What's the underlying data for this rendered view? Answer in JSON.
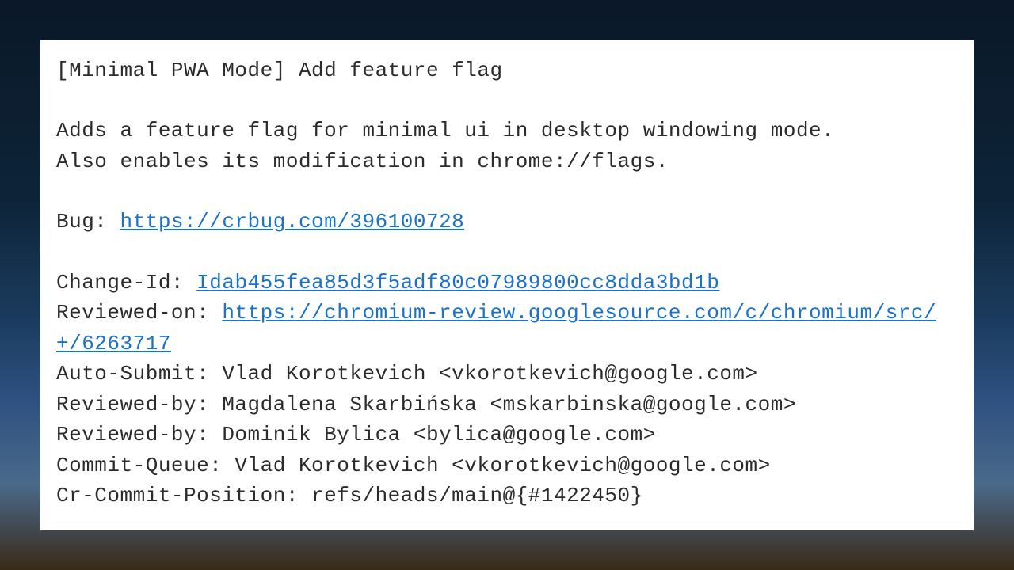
{
  "commit": {
    "title": "[Minimal PWA Mode] Add feature flag",
    "description_line1": "Adds a feature flag for minimal ui in desktop windowing mode.",
    "description_line2": "Also enables its modification in chrome://flags.",
    "bug_label": "Bug: ",
    "bug_url": "https://crbug.com/396100728",
    "change_id_label": "Change-Id: ",
    "change_id": "Idab455fea85d3f5adf80c07989800cc8dda3bd1b",
    "reviewed_on_label": "Reviewed-on: ",
    "reviewed_on_url": "https://chromium-review.googlesource.com/c/chromium/src/+/6263717",
    "auto_submit": "Auto-Submit: Vlad Korotkevich <vkorotkevich@google.com>",
    "reviewed_by_1": "Reviewed-by: Magdalena Skarbińska <mskarbinska@google.com>",
    "reviewed_by_2": "Reviewed-by: Dominik Bylica <bylica@google.com>",
    "commit_queue": "Commit-Queue: Vlad Korotkevich <vkorotkevich@google.com>",
    "cr_commit_position": "Cr-Commit-Position: refs/heads/main@{#1422450}"
  }
}
